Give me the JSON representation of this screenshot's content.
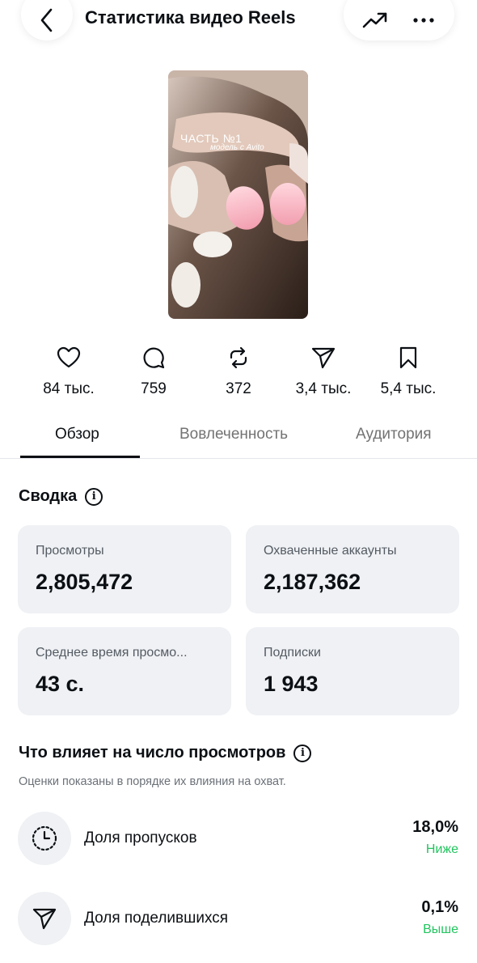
{
  "header": {
    "title": "Статистика видео Reels"
  },
  "video": {
    "caption_line1": "ЧАСТЬ №1",
    "caption_line2": "модель с Avito"
  },
  "stats": {
    "likes": "84 тыс.",
    "comments": "759",
    "reposts": "372",
    "shares": "3,4 тыс.",
    "saves": "5,4 тыс."
  },
  "tabs": [
    {
      "label": "Обзор",
      "active": true
    },
    {
      "label": "Вовлеченность",
      "active": false
    },
    {
      "label": "Аудитория",
      "active": false
    }
  ],
  "summary": {
    "title": "Сводка",
    "cards": [
      {
        "label": "Просмотры",
        "value": "2,805,472"
      },
      {
        "label": "Охваченные аккаунты",
        "value": "2,187,362"
      },
      {
        "label": "Среднее время просмо...",
        "value": "43 с."
      },
      {
        "label": "Подписки",
        "value": "1 943"
      }
    ]
  },
  "factors": {
    "title": "Что влияет на число просмотров",
    "subtitle": "Оценки показаны в порядке их влияния на охват.",
    "items": [
      {
        "label": "Доля пропусков",
        "value": "18,0%",
        "trend": "Ниже",
        "icon": "skip-rate-icon"
      },
      {
        "label": "Доля поделившихся",
        "value": "0,1%",
        "trend": "Выше",
        "icon": "share-icon"
      }
    ]
  },
  "colors": {
    "accent_green": "#22c55e",
    "card_bg": "#eff1f4",
    "text_primary": "#0c1014",
    "text_secondary": "#737373"
  }
}
